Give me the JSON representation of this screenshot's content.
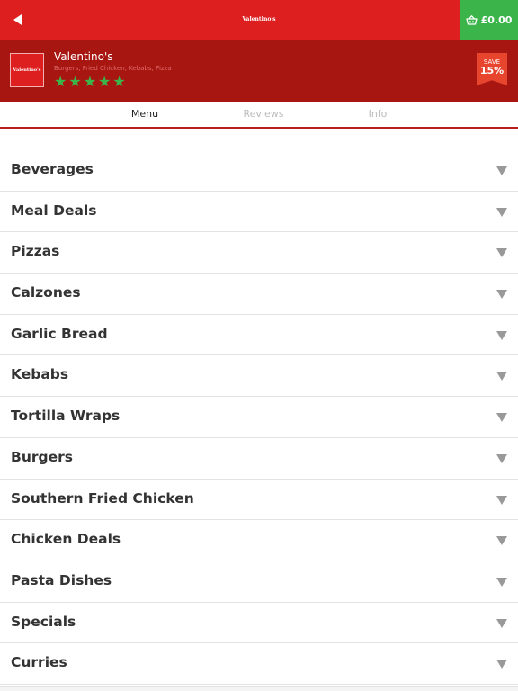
{
  "topbar": {
    "title": "Valentino's",
    "cart_total": "£0.00",
    "back_icon": "back-arrow-icon",
    "cart_icon": "basket-icon",
    "bg_color": "#dd1f1f",
    "cart_color": "#3bb54a"
  },
  "restaurant": {
    "logo_text": "Valentino's",
    "name": "Valentino's",
    "cuisine": "Burgers, Fried Chicken, Kebabs, Pizza",
    "rating": 5,
    "rating_max": 5,
    "star_color": "#3bb54a",
    "save_label": "SAVE",
    "save_percent": "15%"
  },
  "tabs": [
    {
      "label": "Menu",
      "active": true
    },
    {
      "label": "Reviews",
      "active": false
    },
    {
      "label": "Info",
      "active": false
    }
  ],
  "menu": {
    "categories": [
      {
        "label": "Beverages"
      },
      {
        "label": "Meal Deals"
      },
      {
        "label": "Pizzas"
      },
      {
        "label": "Calzones"
      },
      {
        "label": "Garlic Bread"
      },
      {
        "label": "Kebabs"
      },
      {
        "label": "Tortilla Wraps"
      },
      {
        "label": "Burgers"
      },
      {
        "label": "Southern Fried Chicken"
      },
      {
        "label": "Chicken Deals"
      },
      {
        "label": "Pasta Dishes"
      },
      {
        "label": "Specials"
      },
      {
        "label": "Curries"
      }
    ]
  }
}
